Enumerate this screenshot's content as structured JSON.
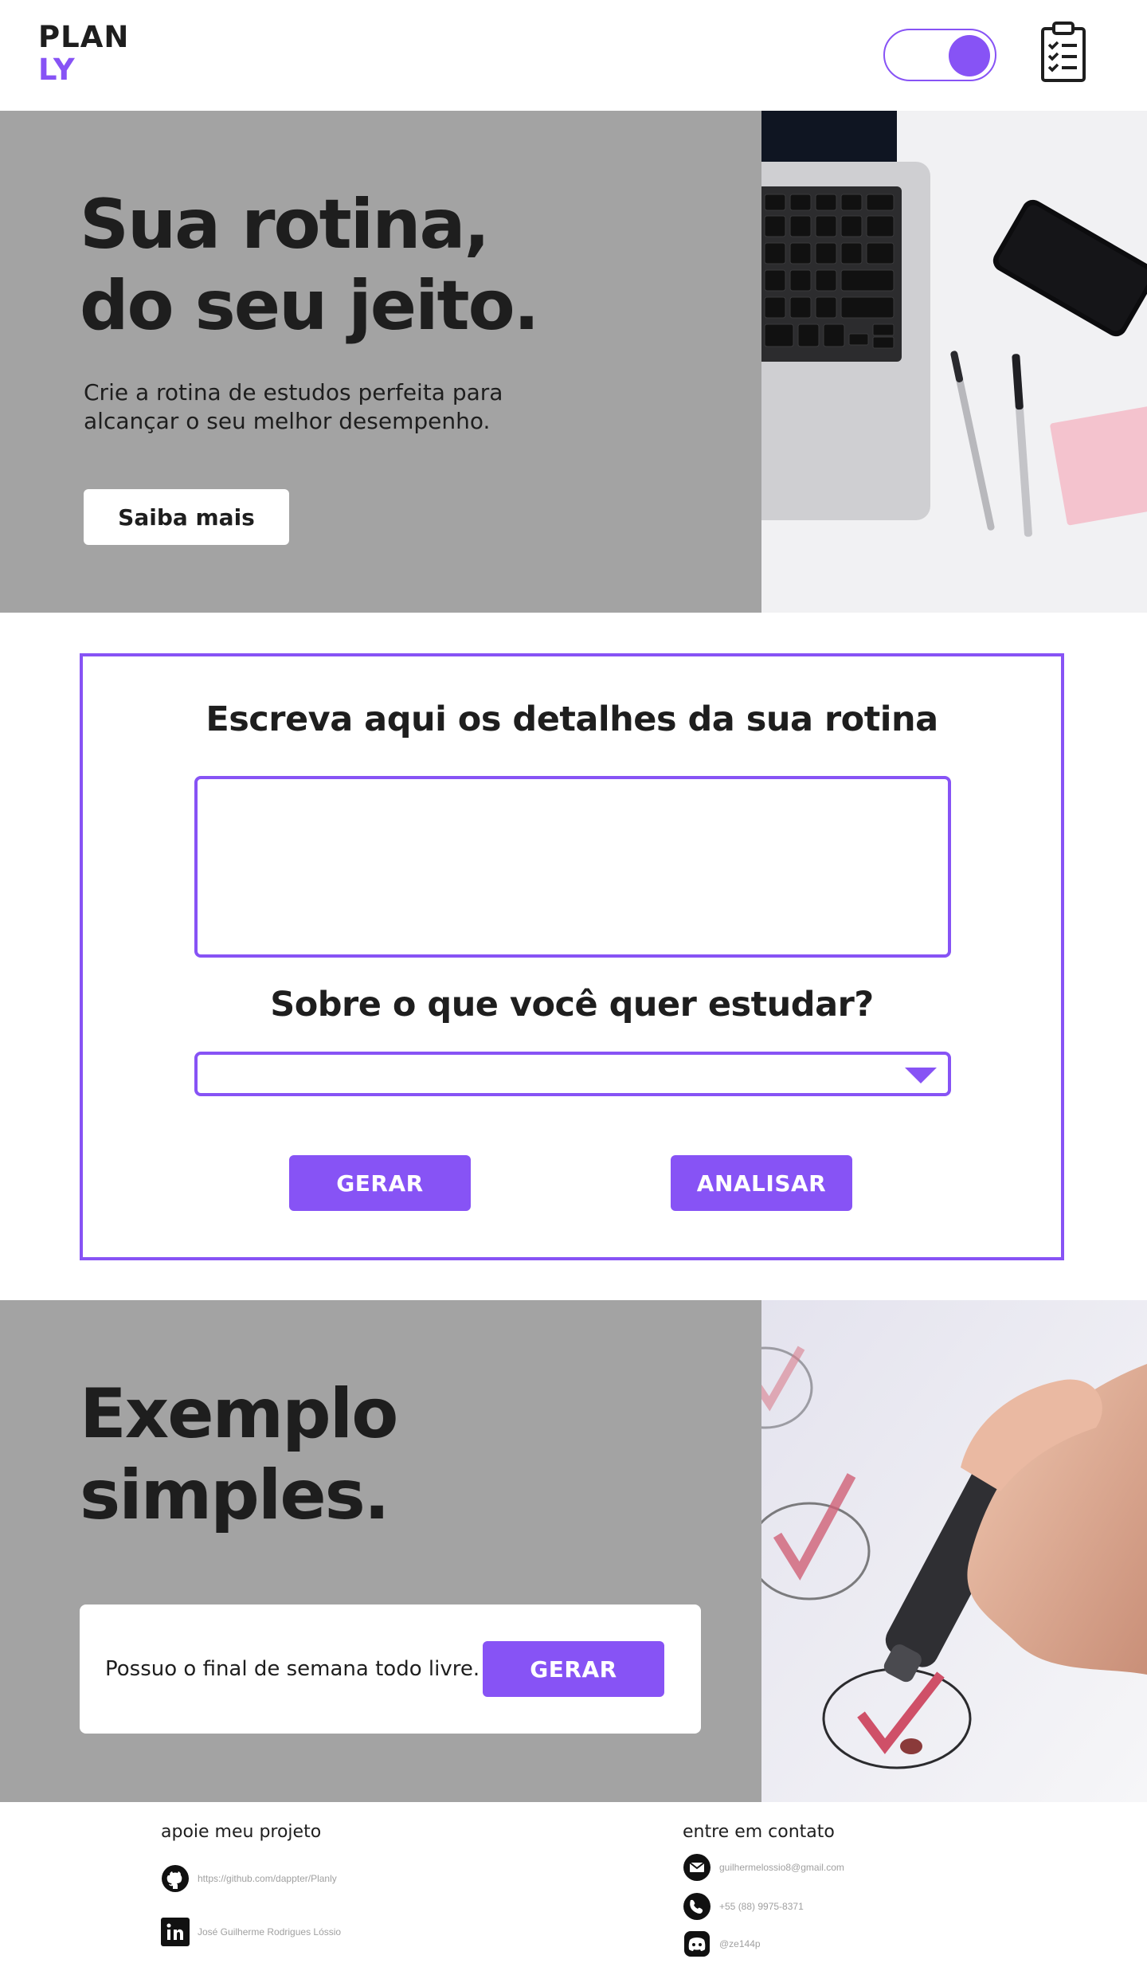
{
  "header": {
    "logo_line1": "PLAN",
    "logo_line2": "LY",
    "theme_toggle": "on",
    "menu_icon": "clipboard-checklist-icon"
  },
  "hero": {
    "title_line1": "Sua rotina,",
    "title_line2": "do seu jeito.",
    "subtitle_line1": "Crie a rotina de estudos perfeita para",
    "subtitle_line2": "alcançar o seu melhor desempenho.",
    "cta_label": "Saiba mais",
    "image": "laptop-phone-pens-photo"
  },
  "form": {
    "heading_details": "Escreva aqui os detalhes da sua rotina",
    "details_value": "",
    "heading_subject": "Sobre o que você quer estudar?",
    "subject_selected": "",
    "generate_label": "GERAR",
    "analyze_label": "ANALISAR"
  },
  "example": {
    "title_line1": "Exemplo",
    "title_line2": "simples.",
    "sample_text": "Possuo o final de semana todo livre.",
    "generate_label": "GERAR",
    "image": "checkmarks-marker-photo"
  },
  "footer": {
    "support_title": "apoie meu projeto",
    "github_text": "https://github.com/dappter/Planly",
    "linkedin_text": "José Guilherme Rodrigues Lóssio",
    "contact_title": "entre em contato",
    "email_text": "guilhermelossio8@gmail.com",
    "phone_text": "+55 (88) 9975-8371",
    "discord_text": "@ze144p"
  },
  "colors": {
    "accent": "#8753f5",
    "section_gray": "#a3a3a3",
    "text_dark": "#1e1e1e"
  }
}
